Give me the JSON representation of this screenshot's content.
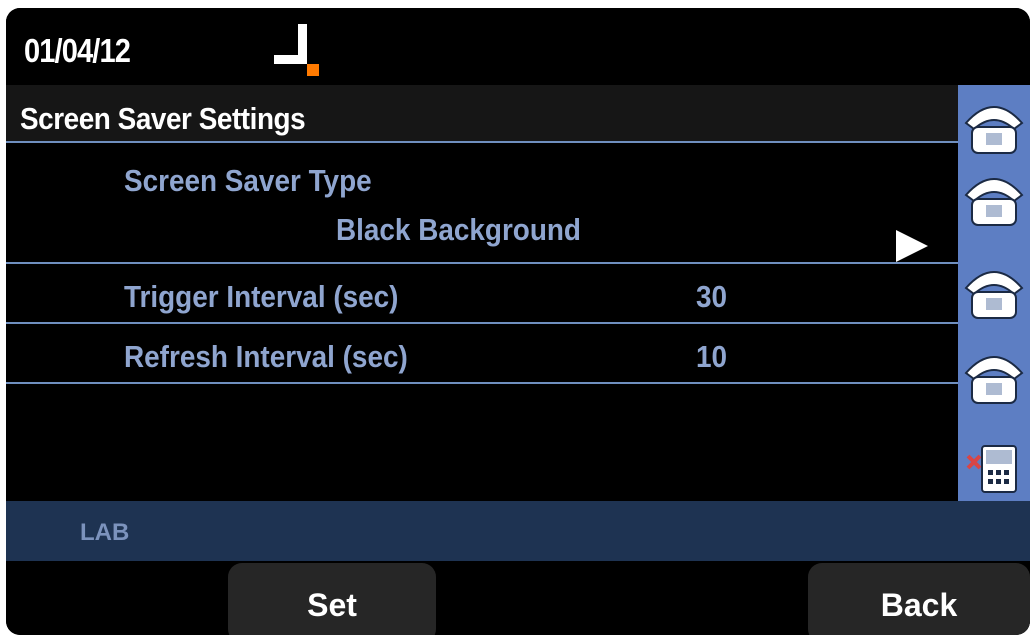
{
  "status": {
    "date": "01/04/12",
    "signal_icon": "signal-icon"
  },
  "settings": {
    "title": "Screen Saver Settings"
  },
  "menu": {
    "type": {
      "label": "Screen Saver Type",
      "value": "Black Background",
      "arrow_icon": "arrow-right-icon"
    },
    "rows": [
      {
        "label": "Trigger Interval  (sec)",
        "value": "30"
      },
      {
        "label": "Refresh  Interval  (sec)",
        "value": "10"
      }
    ]
  },
  "side_keys": [
    {
      "icon": "phone-icon"
    },
    {
      "icon": "phone-icon"
    },
    {
      "icon": "phone-icon"
    },
    {
      "icon": "phone-icon"
    },
    {
      "icon": "forward-phone-icon"
    }
  ],
  "line_label": "LAB",
  "softkeys": {
    "set_label": "Set",
    "back_label": "Back"
  },
  "colors": {
    "accent": "#8fa5cf",
    "side_key_bg": "#5d7ec3",
    "divider": "#6f8fbf",
    "label_bar": "#1e3352",
    "signal_orange": "#ff7a00"
  }
}
